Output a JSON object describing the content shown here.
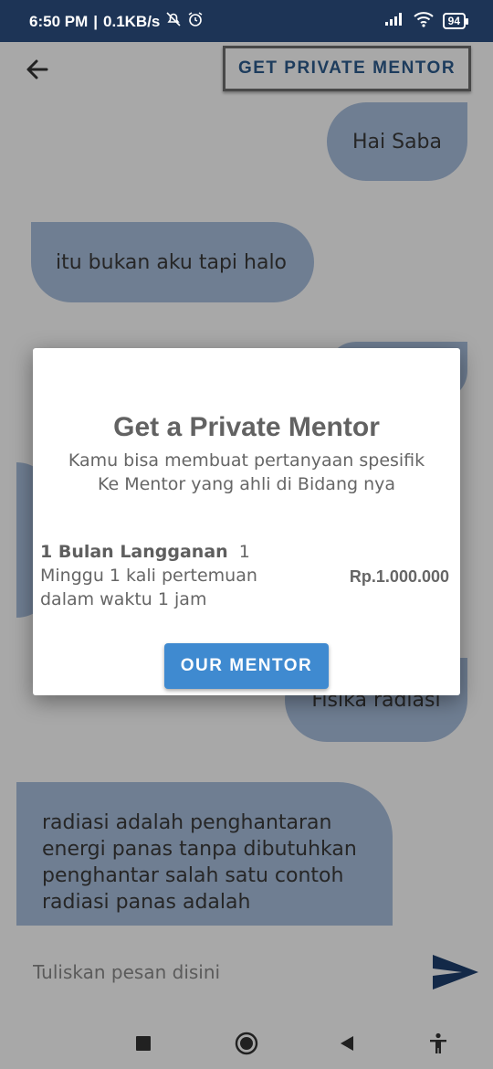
{
  "status_bar": {
    "time": "6:50 PM",
    "separator": "|",
    "net_speed": "0.1KB/s",
    "battery": "94"
  },
  "app_bar": {
    "cta_label": "GET PRIVATE MENTOR"
  },
  "messages": [
    {
      "side": "right",
      "text": "Hai Saba"
    },
    {
      "side": "left",
      "text": "itu bukan aku tapi halo"
    },
    {
      "side": "right",
      "text": ""
    },
    {
      "side": "left",
      "text": ""
    },
    {
      "side": "right",
      "text": "Fisika radiasi"
    },
    {
      "side": "left",
      "text": "radiasi adalah penghantaran energi panas tanpa dibutuhkan penghantar salah satu contoh radiasi panas adalah"
    }
  ],
  "composer": {
    "placeholder": "Tuliskan pesan disini"
  },
  "dialog": {
    "title": "Get a Private Mentor",
    "subtitle_line1": "Kamu bisa membuat pertanyaan spesifik",
    "subtitle_line2": "Ke Mentor yang ahli di Bidang nya",
    "plan_name": "1 Bulan Langganan",
    "plan_detail_line1": "1",
    "plan_detail_line2": "Minggu 1 kali pertemuan",
    "plan_detail_line3": "dalam waktu 1 jam",
    "price": "Rp.1.000.000",
    "button_label": "OUR MENTOR"
  },
  "colors": {
    "status_bar": "#1d3456",
    "bubble": "#a9bfde",
    "accent": "#3f8ad0",
    "cta_text": "#2d5b8e"
  },
  "icons": [
    "do-not-disturb-icon",
    "alarm-icon",
    "signal-icon",
    "wifi-icon",
    "battery-icon",
    "back-arrow-icon",
    "send-icon",
    "recents-icon",
    "home-icon",
    "back-icon",
    "accessibility-icon"
  ]
}
